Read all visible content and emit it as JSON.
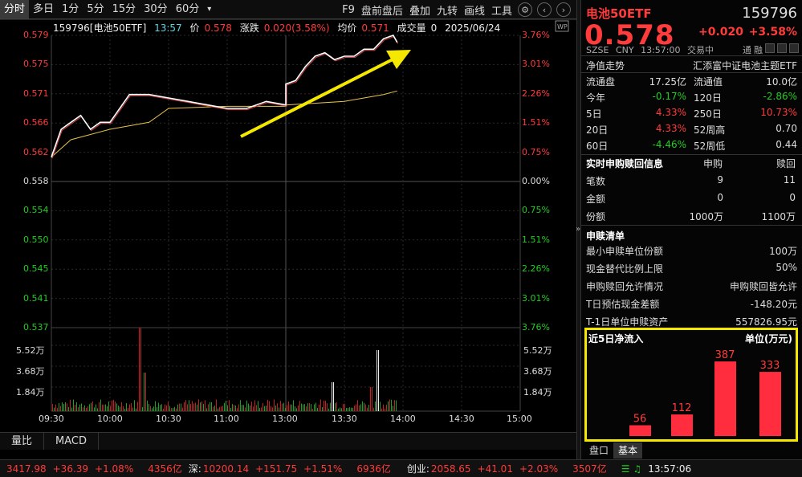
{
  "toolbar": {
    "tabs": [
      "分时",
      "多日",
      "1分",
      "5分",
      "15分",
      "30分",
      "60分"
    ],
    "more": "▾",
    "tools": [
      "F9",
      "盘前盘后",
      "叠加",
      "九转",
      "画线",
      "工具"
    ]
  },
  "info": {
    "code_name": "159796[电池50ETF]",
    "time": "13:57",
    "price_label": "价",
    "price": "0.578",
    "chg_label": "涨跌",
    "chg": "0.020(3.58%)",
    "avg_label": "均价",
    "avg": "0.571",
    "vol_label": "成交量",
    "vol": "0",
    "date": "2025/06/24"
  },
  "left_axis": [
    {
      "v": "0.579",
      "color": "#ff3b3b"
    },
    {
      "v": "0.575",
      "color": "#ff3b3b"
    },
    {
      "v": "0.571",
      "color": "#ff3b3b"
    },
    {
      "v": "0.566",
      "color": "#ff3b3b"
    },
    {
      "v": "0.562",
      "color": "#ff3b3b"
    },
    {
      "v": "0.558",
      "color": "#dddddd"
    },
    {
      "v": "0.554",
      "color": "#22cc22"
    },
    {
      "v": "0.550",
      "color": "#22cc22"
    },
    {
      "v": "0.545",
      "color": "#22cc22"
    },
    {
      "v": "0.541",
      "color": "#22cc22"
    },
    {
      "v": "0.537",
      "color": "#22cc22"
    }
  ],
  "right_axis": [
    {
      "v": "3.76%",
      "color": "#ff3b3b"
    },
    {
      "v": "3.01%",
      "color": "#ff3b3b"
    },
    {
      "v": "2.26%",
      "color": "#ff3b3b"
    },
    {
      "v": "1.51%",
      "color": "#ff3b3b"
    },
    {
      "v": "0.75%",
      "color": "#ff3b3b"
    },
    {
      "v": "0.00%",
      "color": "#dddddd"
    },
    {
      "v": "0.75%",
      "color": "#22cc22"
    },
    {
      "v": "1.51%",
      "color": "#22cc22"
    },
    {
      "v": "2.26%",
      "color": "#22cc22"
    },
    {
      "v": "3.01%",
      "color": "#22cc22"
    },
    {
      "v": "3.76%",
      "color": "#22cc22"
    }
  ],
  "vol_axis": [
    "5.52万",
    "3.68万",
    "1.84万"
  ],
  "x_axis": [
    "09:30",
    "10:00",
    "10:30",
    "11:00",
    "13:00",
    "13:30",
    "14:00",
    "14:30",
    "15:00"
  ],
  "chart_data": [
    {
      "type": "line",
      "series": [
        {
          "name": "价",
          "x": [
            "09:30",
            "09:35",
            "09:40",
            "09:45",
            "09:50",
            "09:55",
            "10:00",
            "10:10",
            "10:20",
            "10:30",
            "10:40",
            "10:50",
            "11:00",
            "11:10",
            "11:20",
            "11:30",
            "13:00",
            "13:05",
            "13:10",
            "13:15",
            "13:20",
            "13:25",
            "13:30",
            "13:35",
            "13:40",
            "13:45",
            "13:50",
            "13:55",
            "13:57"
          ],
          "values": [
            0.5615,
            0.5655,
            0.5665,
            0.5675,
            0.5655,
            0.5665,
            0.5665,
            0.5705,
            0.5705,
            0.57,
            0.5695,
            0.569,
            0.5685,
            0.5685,
            0.5695,
            0.569,
            0.572,
            0.5725,
            0.5745,
            0.576,
            0.5765,
            0.5755,
            0.576,
            0.576,
            0.577,
            0.577,
            0.5785,
            0.579,
            0.578
          ]
        },
        {
          "name": "均价",
          "x": [
            "09:30",
            "09:40",
            "10:00",
            "10:20",
            "10:30",
            "11:00",
            "11:30",
            "13:00",
            "13:30",
            "13:50",
            "13:57"
          ],
          "values": [
            0.5615,
            0.564,
            0.5655,
            0.5665,
            0.5685,
            0.5688,
            0.5688,
            0.569,
            0.5695,
            0.5705,
            0.571
          ]
        }
      ],
      "ylim": [
        0.537,
        0.579
      ]
    },
    {
      "type": "bar",
      "title": "近5日净流入",
      "ylabel": "单位(万元)",
      "values": [
        56,
        112,
        387,
        333
      ]
    }
  ],
  "bottom_tabs": [
    "量比",
    "MACD"
  ],
  "panel": {
    "name": "电池50ETF",
    "code": "159796",
    "price": "0.578",
    "chg": "+0.020",
    "chgp": "+3.58%",
    "meta": [
      "SZSE",
      "CNY",
      "13:57:00",
      "交易中"
    ],
    "meta_tags": [
      "通",
      "融"
    ],
    "nav_title": "净值走势",
    "fund_name": "汇添富中证电池主题ETF",
    "rows": [
      {
        "l1": "流通盘",
        "v1": "17.25亿",
        "c1": "#dddddd",
        "l2": "流通值",
        "v2": "10.0亿",
        "c2": "#dddddd"
      },
      {
        "l1": "今年",
        "v1": "-0.17%",
        "c1": "#22cc22",
        "l2": "120日",
        "v2": "-2.86%",
        "c2": "#22cc22"
      },
      {
        "l1": "5日",
        "v1": "4.33%",
        "c1": "#ff3b3b",
        "l2": "250日",
        "v2": "10.73%",
        "c2": "#ff3b3b"
      },
      {
        "l1": "20日",
        "v1": "4.33%",
        "c1": "#ff3b3b",
        "l2": "52周高",
        "v2": "0.70",
        "c2": "#dddddd"
      },
      {
        "l1": "60日",
        "v1": "-4.46%",
        "c1": "#22cc22",
        "l2": "52周低",
        "v2": "0.44",
        "c2": "#dddddd"
      }
    ],
    "sub_title": "实时申购赎回信息",
    "sub_h1": "申购",
    "sub_h2": "赎回",
    "sub_rows": [
      {
        "l": "笔数",
        "v1": "9",
        "v2": "11"
      },
      {
        "l": "金额",
        "v1": "0",
        "v2": "0"
      },
      {
        "l": "份额",
        "v1": "1000万",
        "v2": "1100万"
      }
    ],
    "list_title": "申赎清单",
    "list_rows": [
      {
        "l": "最小申赎单位份额",
        "v": "100万"
      },
      {
        "l": "现金替代比例上限",
        "v": "50%"
      },
      {
        "l": "申购赎回允许情况",
        "v": "申购赎回皆允许"
      },
      {
        "l": "T日预估现金差额",
        "v": "-148.20元"
      },
      {
        "l": "T-1日单位申赎资产",
        "v": "557826.95元"
      }
    ],
    "flow_title": "近5日净流入",
    "flow_unit": "单位(万元)",
    "tabs": [
      "盘口",
      "基本"
    ]
  },
  "status": {
    "sh_index": "3417.98",
    "sh_chg": "+36.39",
    "sh_pct": "+1.08%",
    "sh_amt": "4356亿",
    "sz_label": "深:",
    "sz_index": "10200.14",
    "sz_chg": "+151.75",
    "sz_pct": "+1.51%",
    "sz_amt": "6936亿",
    "cy_label": "创业:",
    "cy_index": "2058.65",
    "cy_chg": "+41.01",
    "cy_pct": "+2.03%",
    "cy_amt": "3507亿",
    "clock": "13:57:06"
  },
  "colors": {
    "up": "#ff3b3b",
    "down": "#22cc22",
    "highlight": "#f5e800"
  }
}
